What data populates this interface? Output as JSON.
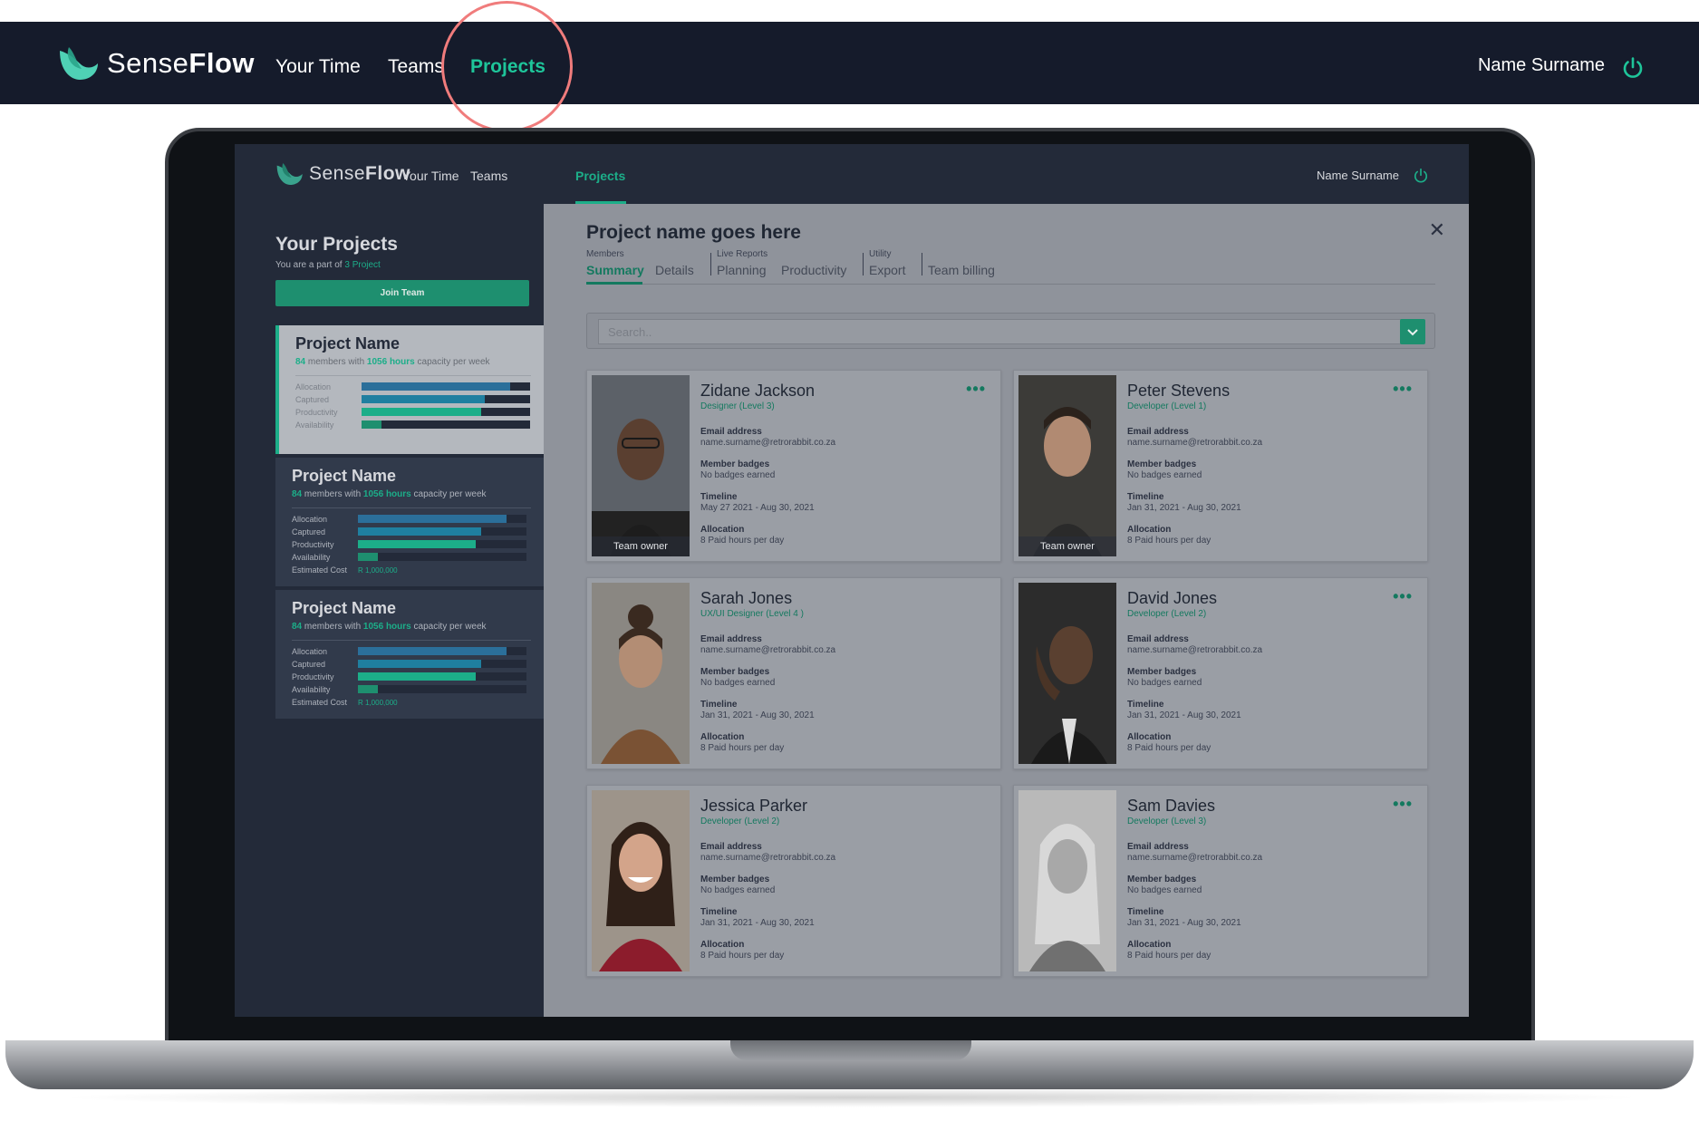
{
  "brand": {
    "name_light": "Sense",
    "name_bold": "Flow"
  },
  "outer_nav": {
    "items": [
      "Your Time",
      "Teams",
      "Projects"
    ],
    "active": "Projects",
    "user": "Name Surname"
  },
  "inner_nav": {
    "items": [
      "Your Time",
      "Teams",
      "Projects"
    ],
    "active": "Projects",
    "user": "Name Surname"
  },
  "sidebar": {
    "title": "Your Projects",
    "subtitle_prefix": "You are a part of ",
    "subtitle_link": "3 Project",
    "join_label": "Join Team",
    "metric_labels": [
      "Allocation",
      "Captured",
      "Productivity",
      "Availability"
    ],
    "cost_label": "Estimated Cost",
    "projects": [
      {
        "name": "Project Name",
        "members": "84",
        "members_suffix": " members with ",
        "hours": "1056 hours",
        "hours_suffix": " capacity per week",
        "metrics": [
          0.88,
          0.73,
          0.71,
          0.12
        ],
        "cost": ""
      },
      {
        "name": "Project Name",
        "members": "84",
        "members_suffix": " members with ",
        "hours": "1056 hours",
        "hours_suffix": " capacity per week",
        "metrics": [
          0.88,
          0.73,
          0.7,
          0.12
        ],
        "cost": "R 1,000,000"
      },
      {
        "name": "Project Name",
        "members": "84",
        "members_suffix": " members with ",
        "hours": "1056 hours",
        "hours_suffix": " capacity per week",
        "metrics": [
          0.88,
          0.73,
          0.7,
          0.12
        ],
        "cost": "R 1,000,000"
      }
    ]
  },
  "main": {
    "project_title": "Project name goes here",
    "tab_groups": [
      {
        "label": "Members",
        "tabs": [
          "Summary",
          "Details"
        ]
      },
      {
        "label": "Live Reports",
        "tabs": [
          "Planning",
          "Productivity"
        ]
      },
      {
        "label": "Utility",
        "tabs": [
          "Export"
        ]
      },
      {
        "label": "",
        "tabs": [
          "Team billing"
        ]
      }
    ],
    "active_tab": "Summary",
    "search_placeholder": "Search..",
    "field_labels": {
      "email": "Email address",
      "badges": "Member badges",
      "timeline": "Timeline",
      "allocation": "Allocation"
    },
    "owner_label": "Team owner",
    "members": [
      {
        "name": "Zidane Jackson",
        "role": "Designer (Level 3)",
        "email": "name.surname@retrorabbit.co.za",
        "badges": "No badges earned",
        "timeline": "May 27  2021 - Aug 30, 2021",
        "allocation": "8 Paid hours per day",
        "owner": true
      },
      {
        "name": "Peter Stevens",
        "role": "Developer (Level 1)",
        "email": "name.surname@retrorabbit.co.za",
        "badges": "No badges earned",
        "timeline": "Jan 31, 2021 - Aug 30, 2021",
        "allocation": "8 Paid hours per day",
        "owner": true
      },
      {
        "name": "Sarah Jones",
        "role": "UX/UI Designer (Level 4 )",
        "email": "name.surname@retrorabbit.co.za",
        "badges": "No badges earned",
        "timeline": "Jan 31, 2021 - Aug 30, 2021",
        "allocation": "8 Paid hours per day",
        "owner": false
      },
      {
        "name": "David Jones",
        "role": "Developer (Level 2)",
        "email": "name.surname@retrorabbit.co.za",
        "badges": "No badges earned",
        "timeline": "Jan 31, 2021 - Aug 30, 2021",
        "allocation": "8 Paid hours per day",
        "owner": false
      },
      {
        "name": "Jessica Parker",
        "role": "Developer (Level 2)",
        "email": "name.surname@retrorabbit.co.za",
        "badges": "No badges earned",
        "timeline": "Jan 31, 2021 - Aug 30, 2021",
        "allocation": "8 Paid hours per day",
        "owner": false
      },
      {
        "name": "Sam Davies",
        "role": "Developer (Level 3)",
        "email": "name.surname@retrorabbit.co.za",
        "badges": "No badges earned",
        "timeline": "Jan 31, 2021 - Aug 30, 2021",
        "allocation": "8 Paid hours per day",
        "owner": false
      }
    ]
  },
  "colors": {
    "accent": "#1ec59a",
    "nav_bg": "#151b2b",
    "highlight_ring": "#f07c7c",
    "bar_allocation": "#2b6f9a",
    "bar_captured": "#1f7fa0",
    "bar_productivity": "#1cae89",
    "bar_availability": "#1e8f6f"
  },
  "icons": {
    "logo": "senseflow-logo-icon",
    "power": "power-icon",
    "close": "close-icon",
    "dropdown": "chevron-down-icon",
    "more": "more-dots-icon"
  }
}
